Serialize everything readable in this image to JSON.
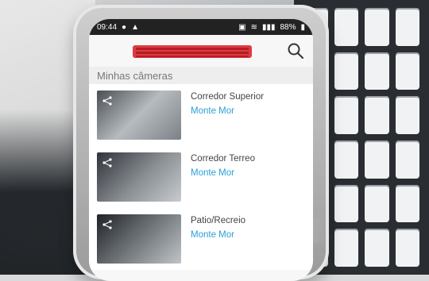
{
  "status": {
    "time": "09:44",
    "battery": "88%"
  },
  "app": {
    "section_title": "Minhas câmeras"
  },
  "cameras": [
    {
      "name": "Corredor Superior",
      "location": "Monte Mor"
    },
    {
      "name": "Corredor Terreo",
      "location": "Monte Mor"
    },
    {
      "name": "Patio/Recreio",
      "location": "Monte Mor"
    }
  ],
  "icons": {
    "search": "search-icon",
    "share": "share-icon"
  },
  "colors": {
    "accent": "#2aa0d6",
    "status_bg": "#222222"
  }
}
